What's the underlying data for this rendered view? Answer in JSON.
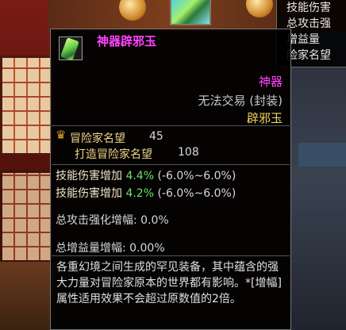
{
  "background_tooltip": {
    "lines": [
      "技能伤害",
      "总攻击强",
      "增益量",
      "险家名望"
    ]
  },
  "tooltip": {
    "item_icon": "jade-talisman-icon",
    "item_name": "神器辟邪玉",
    "rarity": "神器",
    "trade_status": "无法交易 (封装)",
    "sub_name": "辟邪玉",
    "fame": {
      "icon": "fame-crown-icon",
      "label": "冒险家名望",
      "value": "45"
    },
    "forge_fame": {
      "label": "打造冒险家名望",
      "value": "108"
    },
    "skills": [
      {
        "label": "技能伤害增加",
        "percent": "4.4%",
        "range": "(-6.0%~6.0%)"
      },
      {
        "label": "技能伤害增加",
        "percent": "4.2%",
        "range": "(-6.0%~6.0%)"
      }
    ],
    "attack_boost": "总攻击强化增幅: 0.0%",
    "gain_boost": "总增益量增幅: 0.00%",
    "description": "各重幻境之间生成的罕见装备，其中蕴含的强大力量对冒险家原本的世界都有影响。*[增幅]属性适用效果不会超过原数值的2倍。"
  },
  "colors": {
    "epic": "#ff44ff",
    "gold": "#f0d460",
    "positive": "#6ce06c"
  }
}
